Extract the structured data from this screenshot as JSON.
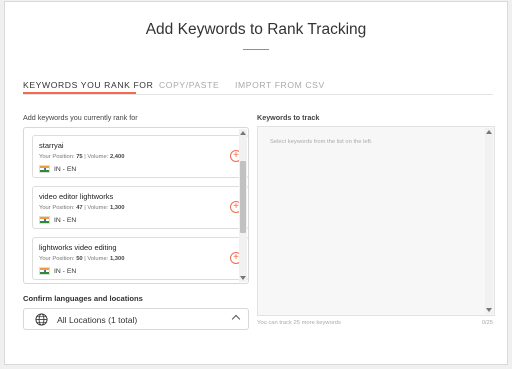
{
  "header": {
    "title": "Add Keywords to Rank Tracking"
  },
  "tabs": [
    {
      "label": "KEYWORDS YOU RANK FOR",
      "active": true
    },
    {
      "label": "COPY/PASTE",
      "active": false
    },
    {
      "label": "IMPORT FROM CSV",
      "active": false
    }
  ],
  "left_panel": {
    "label": "Add keywords you currently rank for",
    "position_label": "Your Position:",
    "volume_label": "Volume:",
    "keywords": [
      {
        "keyword": "starryai",
        "position": "75",
        "volume": "2,400",
        "locale": "IN - EN",
        "flag_icon": "india-flag-icon"
      },
      {
        "keyword": "video editor lightworks",
        "position": "47",
        "volume": "1,300",
        "locale": "IN - EN",
        "flag_icon": "india-flag-icon"
      },
      {
        "keyword": "lightworks video editing",
        "position": "50",
        "volume": "1,300",
        "locale": "IN - EN",
        "flag_icon": "india-flag-icon"
      }
    ],
    "scroll_position": 0.12
  },
  "right_panel": {
    "label": "Keywords to track",
    "placeholder": "Select keywords from the list on the left.",
    "info": "You can track 25 more keywords",
    "count": "0/25"
  },
  "locations": {
    "label": "Confirm languages and locations",
    "selected": "All Locations (1 total)",
    "icon": "globe-icon"
  },
  "colors": {
    "accent": "#f26b4f",
    "text": "#333333",
    "muted": "#aaaaaa"
  }
}
